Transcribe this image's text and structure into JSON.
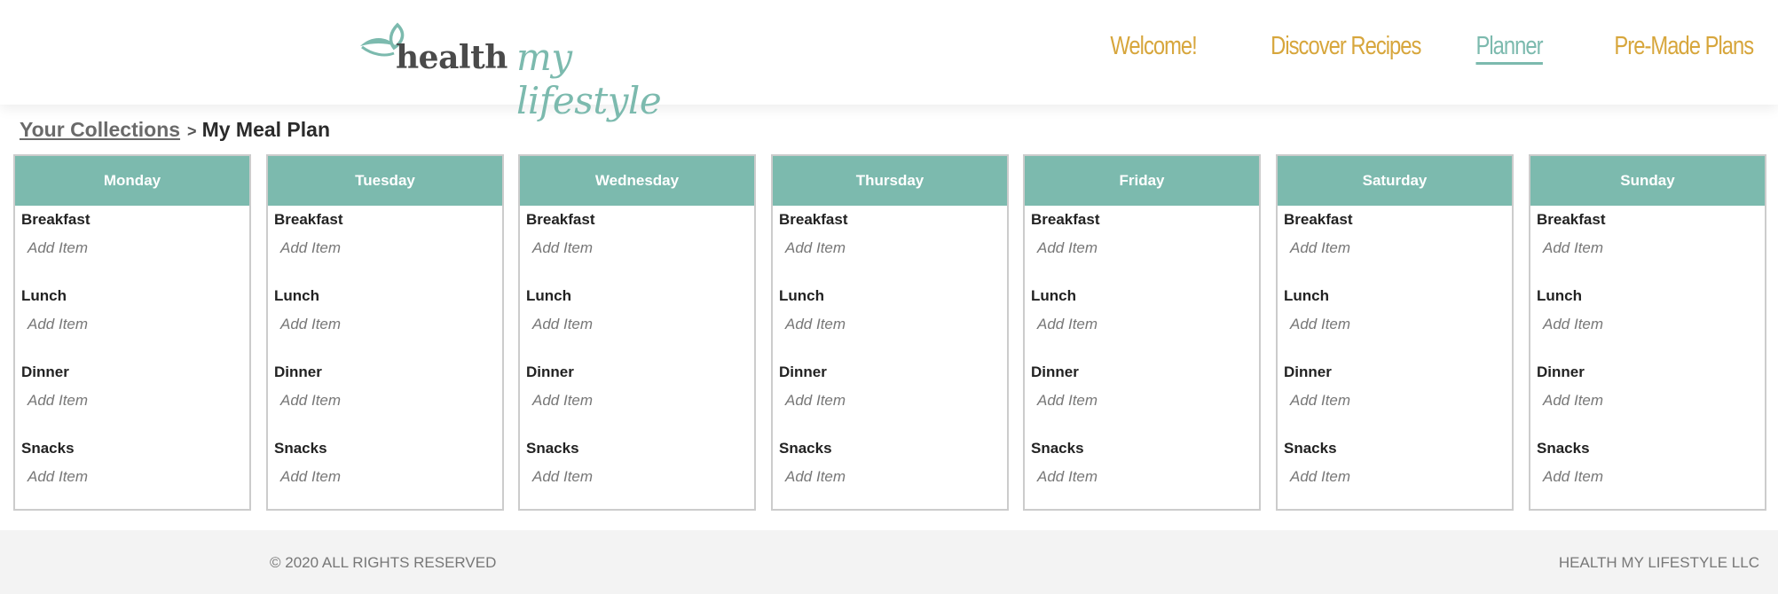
{
  "brand": {
    "name_part1": "health",
    "name_part2": "my lifestyle",
    "primary_color": "#7cbaae",
    "accent_color": "#d7a63c"
  },
  "nav": {
    "items": [
      {
        "label": "Welcome!",
        "active": false
      },
      {
        "label": "Discover Recipes",
        "active": false
      },
      {
        "label": "Planner",
        "active": true
      },
      {
        "label": "Pre-Made Plans",
        "active": false
      }
    ]
  },
  "breadcrumb": {
    "parent": "Your Collections",
    "separator": ">",
    "current": "My Meal Plan"
  },
  "planner": {
    "add_item_label": "Add Item",
    "meals": [
      "Breakfast",
      "Lunch",
      "Dinner",
      "Snacks"
    ],
    "days": [
      {
        "name": "Monday"
      },
      {
        "name": "Tuesday"
      },
      {
        "name": "Wednesday"
      },
      {
        "name": "Thursday"
      },
      {
        "name": "Friday"
      },
      {
        "name": "Saturday"
      },
      {
        "name": "Sunday"
      }
    ]
  },
  "footer": {
    "copyright": "© 2020 ALL RIGHTS RESERVED",
    "company": "HEALTH MY LIFESTYLE LLC"
  }
}
